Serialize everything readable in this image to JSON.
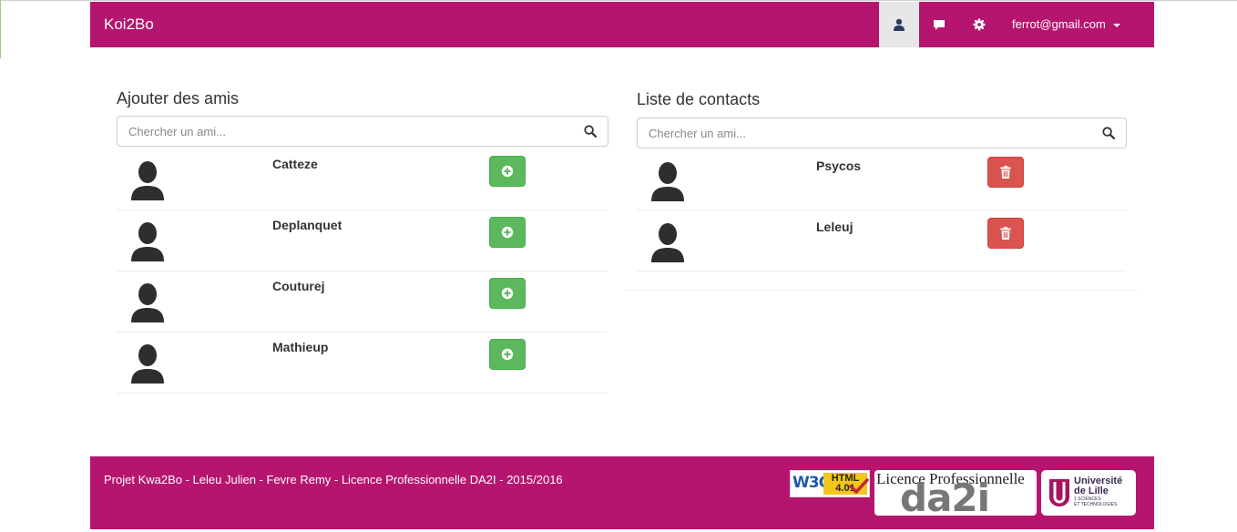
{
  "navbar": {
    "brand": "Koi2Bo",
    "profile_icon": "user-icon",
    "messages_icon": "comment-icon",
    "settings_icon": "gear-icon",
    "user_email": "ferrot@gmail.com"
  },
  "add_friends": {
    "title": "Ajouter des amis",
    "search_placeholder": "Chercher un ami...",
    "people": [
      {
        "name": "Catteze",
        "action_icon": "plus-circle-icon"
      },
      {
        "name": "Deplanquet",
        "action_icon": "plus-circle-icon"
      },
      {
        "name": "Couturej",
        "action_icon": "plus-circle-icon"
      },
      {
        "name": "Mathieup",
        "action_icon": "plus-circle-icon"
      }
    ]
  },
  "contacts": {
    "title": "Liste de contacts",
    "search_placeholder": "Chercher un ami...",
    "people": [
      {
        "name": "Psycos",
        "action_icon": "trash-icon"
      },
      {
        "name": "Leleuj",
        "action_icon": "trash-icon"
      }
    ]
  },
  "footer": {
    "text": "Projet Kwa2Bo - Leleu Julien - Fevre Remy - Licence Professionnelle DA2I - 2015/2016",
    "w3c_badge": {
      "w3c": "W3C",
      "html": "HTML",
      "version": "4.01"
    },
    "lp_logo": {
      "line1": "Licence Professionnelle",
      "line2": "da2i"
    },
    "univ_logo": {
      "line1": "Université",
      "line2": "de Lille",
      "line3": "1 SCIENCES",
      "line4": "ET TECHNOLOGIES"
    }
  },
  "colors": {
    "brand": "#b5156f",
    "add": "#5cb85c",
    "delete": "#d9534f"
  }
}
